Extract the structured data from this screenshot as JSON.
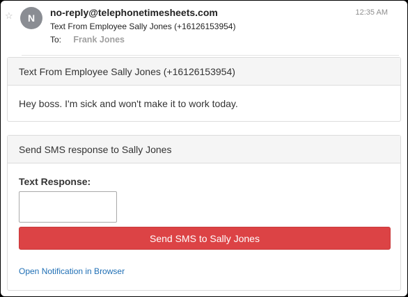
{
  "header": {
    "sender": "no-reply@telephonetimesheets.com",
    "avatar_initial": "N",
    "time": "12:35 AM",
    "subject": "Text From Employee Sally Jones (+16126153954)",
    "to_label": "To:",
    "recipient": "Frank Jones"
  },
  "message_panel": {
    "title": "Text From Employee Sally Jones (+16126153954)",
    "body": "Hey boss. I'm sick and won't make it to work today."
  },
  "response_panel": {
    "title": "Send SMS response to Sally Jones",
    "field_label": "Text Response:",
    "field_value": "",
    "send_button_label": "Send SMS to Sally Jones",
    "open_link_label": "Open Notification in Browser"
  },
  "colors": {
    "button": "#dc4345",
    "link": "#1f6fb5",
    "avatar": "#8a8d93"
  },
  "icons": {
    "star": "star-outline-icon"
  }
}
